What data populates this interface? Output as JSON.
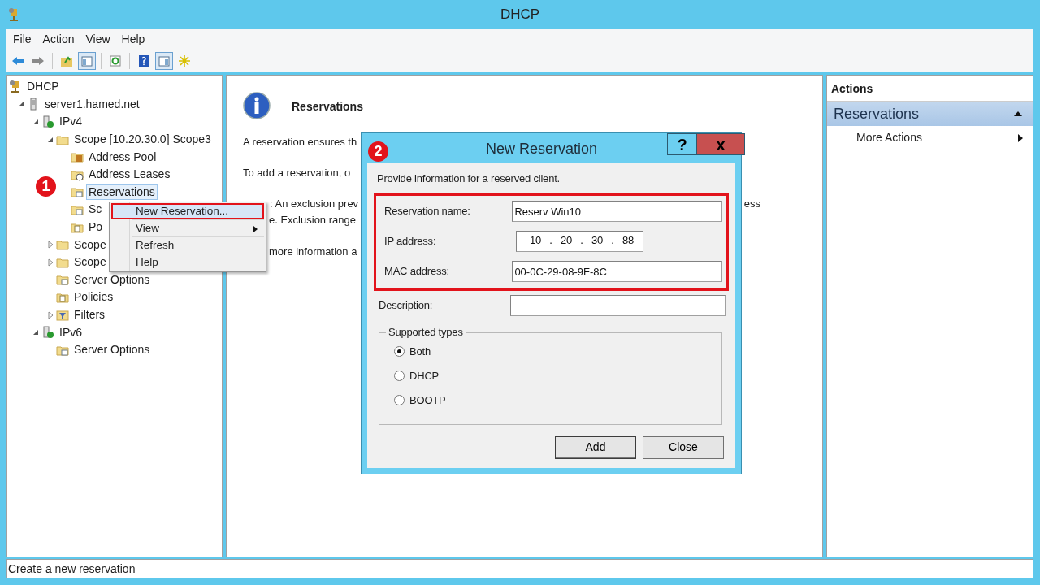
{
  "window": {
    "title": "DHCP"
  },
  "menu": [
    "File",
    "Action",
    "View",
    "Help"
  ],
  "toolbar": [
    {
      "kind": "back"
    },
    {
      "kind": "forward"
    },
    {
      "kind": "sep"
    },
    {
      "kind": "up"
    },
    {
      "kind": "tree",
      "pressed": true
    },
    {
      "kind": "sep"
    },
    {
      "kind": "refresh"
    },
    {
      "kind": "sep"
    },
    {
      "kind": "help"
    },
    {
      "kind": "actionpane",
      "pressed": true
    },
    {
      "kind": "new"
    }
  ],
  "tree": [
    {
      "label": "DHCP",
      "kind": "root",
      "selected": false,
      "children": [
        {
          "label": "server1.hamed.net",
          "kind": "server",
          "selected": false,
          "expanded": true,
          "children": [
            {
              "label": "IPv4",
              "kind": "protocol",
              "selected": false,
              "expanded": true,
              "children": [
                {
                  "label": "Scope [10.20.30.0] Scope3",
                  "kind": "folder",
                  "selected": false,
                  "expanded": true,
                  "children": [
                    {
                      "label": "Address Pool",
                      "kind": "pool",
                      "selected": false
                    },
                    {
                      "label": "Address Leases",
                      "kind": "leases",
                      "selected": false
                    },
                    {
                      "label": "Reservations",
                      "kind": "options",
                      "selected": true
                    },
                    {
                      "label": "Sc",
                      "kind": "options",
                      "selected": false
                    },
                    {
                      "label": "Po",
                      "kind": "policy",
                      "selected": false
                    }
                  ]
                },
                {
                  "label": "Scope",
                  "kind": "folder",
                  "selected": false,
                  "expanded": false
                },
                {
                  "label": "Scope",
                  "kind": "folder",
                  "selected": false,
                  "expanded": false
                },
                {
                  "label": "Server Options",
                  "kind": "options",
                  "selected": false
                },
                {
                  "label": "Policies",
                  "kind": "policy",
                  "selected": false
                },
                {
                  "label": "Filters",
                  "kind": "filter",
                  "selected": false,
                  "expanded": false
                }
              ]
            },
            {
              "label": "IPv6",
              "kind": "protocol",
              "selected": false,
              "expanded": true,
              "children": [
                {
                  "label": "Server Options",
                  "kind": "options",
                  "selected": false
                }
              ]
            }
          ]
        }
      ]
    }
  ],
  "context_menu": [
    {
      "label": "New Reservation...",
      "selected": true,
      "outlined": true,
      "submenu": false
    },
    {
      "label": "View",
      "selected": false,
      "outlined": false,
      "submenu": true
    },
    {
      "label": "Refresh",
      "selected": false,
      "outlined": false,
      "submenu": false
    },
    {
      "label": "Help",
      "selected": false,
      "outlined": false,
      "submenu": false
    }
  ],
  "content": {
    "heading": "Reservations",
    "lines": [
      {
        "text": "A reservation ensures th"
      },
      {
        "text": "To add a reservation, o"
      },
      {
        "text": ": An exclusion prev",
        "right": "ess"
      },
      {
        "text": "e.  Exclusion range"
      },
      {
        "text": "more information a"
      }
    ]
  },
  "actions": {
    "header": "Actions",
    "section": {
      "label": "Reservations",
      "expanded": true
    },
    "items": [
      {
        "label": "More Actions",
        "submenu": true
      }
    ]
  },
  "dialog": {
    "title": "New Reservation",
    "help": "?",
    "close": "x",
    "intro": "Provide information for a reserved client.",
    "name_label": "Reservation name:",
    "name_value": "Reserv Win10",
    "ip_label": "IP address:",
    "ip_octets": [
      "10",
      "20",
      "30",
      "88"
    ],
    "ip_separator": ".",
    "mac_label": "MAC address:",
    "mac_value": "00-0C-29-08-9F-8C",
    "description_label": "Description:",
    "types_legend": "Supported types",
    "types": [
      {
        "label": "Both",
        "selected": true
      },
      {
        "label": "DHCP",
        "selected": false
      },
      {
        "label": "BOOTP",
        "selected": false
      }
    ],
    "buttons": [
      "Add",
      "Close"
    ]
  },
  "callouts": [
    "1",
    "2"
  ],
  "status_bar": "Create a new reservation"
}
